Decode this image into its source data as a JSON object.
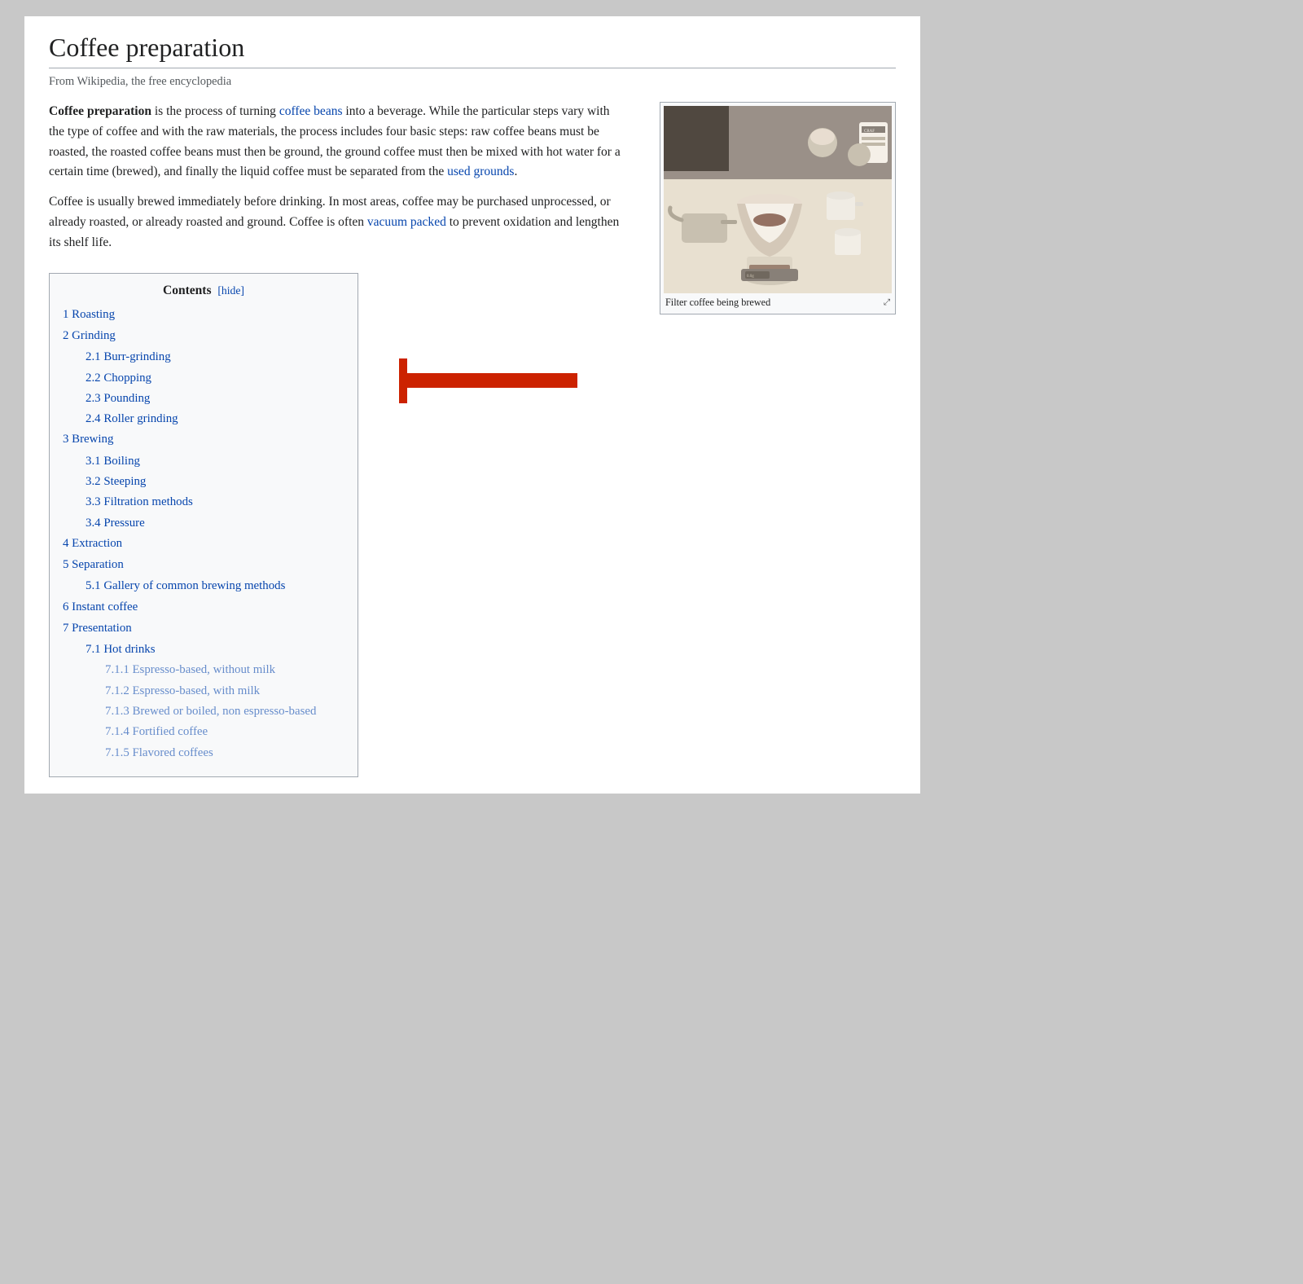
{
  "page": {
    "title": "Coffee preparation",
    "subtitle": "From Wikipedia, the free encyclopedia",
    "intro1_bold": "Coffee preparation",
    "intro1_rest": " is the process of turning ",
    "intro1_link1": "coffee beans",
    "intro1_cont": " into a beverage. While the particular steps vary with the type of coffee and with the raw materials, the process includes four basic steps: raw coffee beans must be roasted, the roasted coffee beans must then be ground, the ground coffee must then be mixed with hot water for a certain time (brewed), and finally the liquid coffee must be separated from the ",
    "intro1_link2": "used grounds",
    "intro1_end": ".",
    "intro2": "Coffee is usually brewed immediately before drinking. In most areas, coffee may be purchased unprocessed, or already roasted, or already roasted and ground. Coffee is often ",
    "intro2_link": "vacuum packed",
    "intro2_end": " to prevent oxidation and lengthen its shelf life.",
    "image_caption": "Filter coffee being brewed",
    "toc": {
      "title": "Contents",
      "hide_label": "[hide]",
      "items": [
        {
          "num": "1",
          "label": "Roasting",
          "level": 0
        },
        {
          "num": "2",
          "label": "Grinding",
          "level": 0
        },
        {
          "num": "2.1",
          "label": "Burr-grinding",
          "level": 1
        },
        {
          "num": "2.2",
          "label": "Chopping",
          "level": 1
        },
        {
          "num": "2.3",
          "label": "Pounding",
          "level": 1
        },
        {
          "num": "2.4",
          "label": "Roller grinding",
          "level": 1
        },
        {
          "num": "3",
          "label": "Brewing",
          "level": 0
        },
        {
          "num": "3.1",
          "label": "Boiling",
          "level": 1
        },
        {
          "num": "3.2",
          "label": "Steeping",
          "level": 1
        },
        {
          "num": "3.3",
          "label": "Filtration methods",
          "level": 1
        },
        {
          "num": "3.4",
          "label": "Pressure",
          "level": 1
        },
        {
          "num": "4",
          "label": "Extraction",
          "level": 0
        },
        {
          "num": "5",
          "label": "Separation",
          "level": 0
        },
        {
          "num": "5.1",
          "label": "Gallery of common brewing methods",
          "level": 1
        },
        {
          "num": "6",
          "label": "Instant coffee",
          "level": 0
        },
        {
          "num": "7",
          "label": "Presentation",
          "level": 0
        },
        {
          "num": "7.1",
          "label": "Hot drinks",
          "level": 1
        },
        {
          "num": "7.1.1",
          "label": "Espresso-based, without milk",
          "level": 2
        },
        {
          "num": "7.1.2",
          "label": "Espresso-based, with milk",
          "level": 2
        },
        {
          "num": "7.1.3",
          "label": "Brewed or boiled, non espresso-based",
          "level": 2
        },
        {
          "num": "7.1.4",
          "label": "Fortified coffee",
          "level": 2
        },
        {
          "num": "7.1.5",
          "label": "Flavored coffees",
          "level": 2
        }
      ]
    }
  }
}
